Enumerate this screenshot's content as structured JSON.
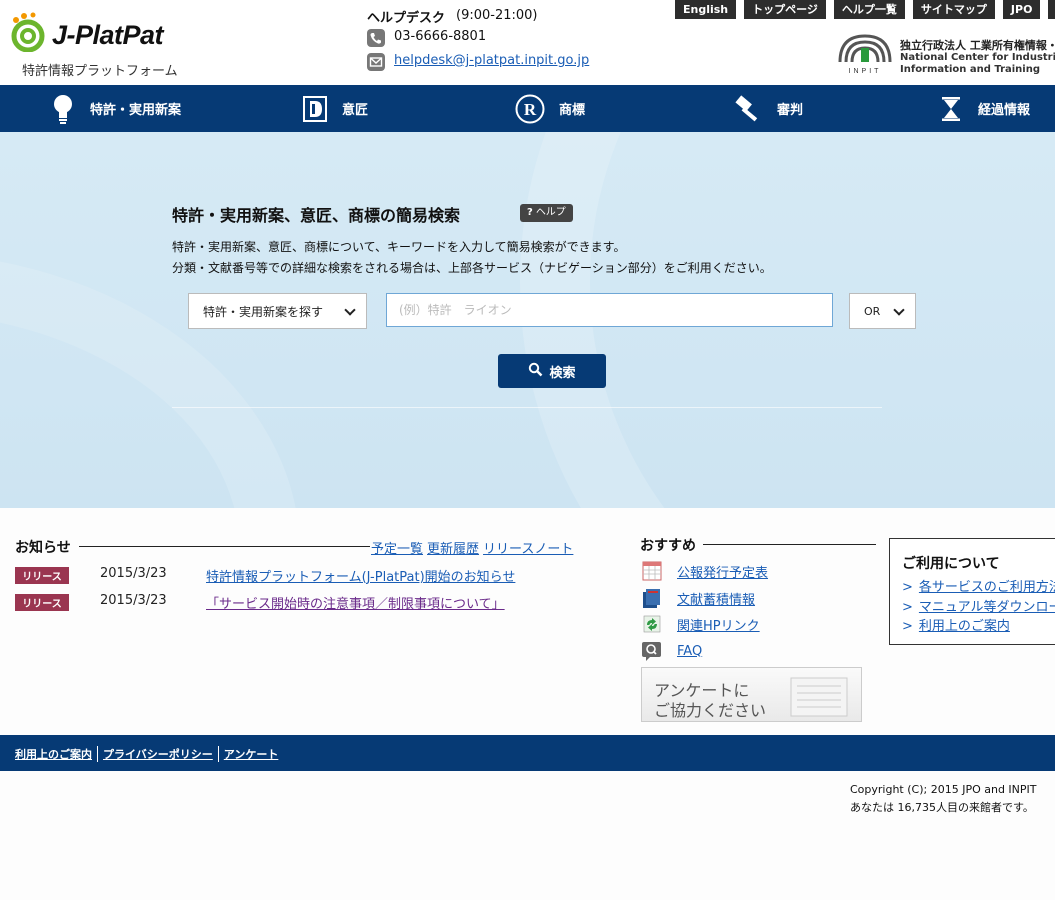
{
  "header": {
    "logo_text": "J-PlatPat",
    "logo_subtitle": "特許情報プラットフォーム",
    "helpdesk": {
      "title": "ヘルプデスク",
      "hours": "(9:00-21:00)",
      "phone": "03-6666-8801",
      "email": "helpdesk@j-platpat.inpit.go.jp"
    },
    "top_links": [
      "English",
      "トップページ",
      "ヘルプ一覧",
      "サイトマップ",
      "JPO",
      "文"
    ],
    "inpit": {
      "line1": "独立行政法人 工業所有権情報・",
      "line2": "National Center for Industrial Pr",
      "line3": "Information and Training",
      "logo_word": "INPIT"
    }
  },
  "nav": {
    "items": [
      {
        "label": "特許・実用新案",
        "icon": "lightbulb-icon"
      },
      {
        "label": "意匠",
        "icon": "design-d-icon"
      },
      {
        "label": "商標",
        "icon": "registered-r-icon"
      },
      {
        "label": "審判",
        "icon": "gavel-icon"
      },
      {
        "label": "経過情報",
        "icon": "hourglass-icon"
      }
    ]
  },
  "search": {
    "title": "特許・実用新案、意匠、商標の簡易検索",
    "help_label": "ヘルプ",
    "description_1": "特許・実用新案、意匠、商標について、キーワードを入力して簡易検索ができます。",
    "description_2": "分類・文献番号等での詳細な検索をされる場合は、上部各サービス（ナビゲーション部分）をご利用ください。",
    "category_value": "特許・実用新案を探す",
    "keyword_placeholder": "(例）特許　ライオン",
    "operator_value": "OR",
    "button_label": "検索"
  },
  "news": {
    "heading": "お知らせ",
    "links": [
      "予定一覧",
      "更新履歴",
      "リリースノート"
    ],
    "items": [
      {
        "badge": "リリース",
        "date": "2015/3/23",
        "title": "特許情報プラットフォーム(J-PlatPat)開始のお知らせ"
      },
      {
        "badge": "リリース",
        "date": "2015/3/23",
        "title": "「サービス開始時の注意事項／制限事項について」"
      }
    ]
  },
  "recommend": {
    "heading": "おすすめ",
    "items": [
      {
        "label": "公報発行予定表",
        "icon": "calendar-icon"
      },
      {
        "label": "文献蓄積情報",
        "icon": "books-icon"
      },
      {
        "label": "関連HPリンク",
        "icon": "recycle-link-icon"
      },
      {
        "label": "FAQ",
        "icon": "faq-icon"
      }
    ],
    "survey_line1": "アンケートに",
    "survey_line2": "ご協力ください"
  },
  "usage": {
    "heading": "ご利用について",
    "links": [
      "各サービスのご利用方法",
      "マニュアル等ダウンロード",
      "利用上のご案内"
    ]
  },
  "footer": {
    "links": [
      "利用上のご案内",
      "プライバシーポリシー",
      "アンケート"
    ],
    "copyright": "Copyright (C); 2015 JPO and INPIT",
    "visitor": "あなたは 16,735人目の来館者です。"
  }
}
